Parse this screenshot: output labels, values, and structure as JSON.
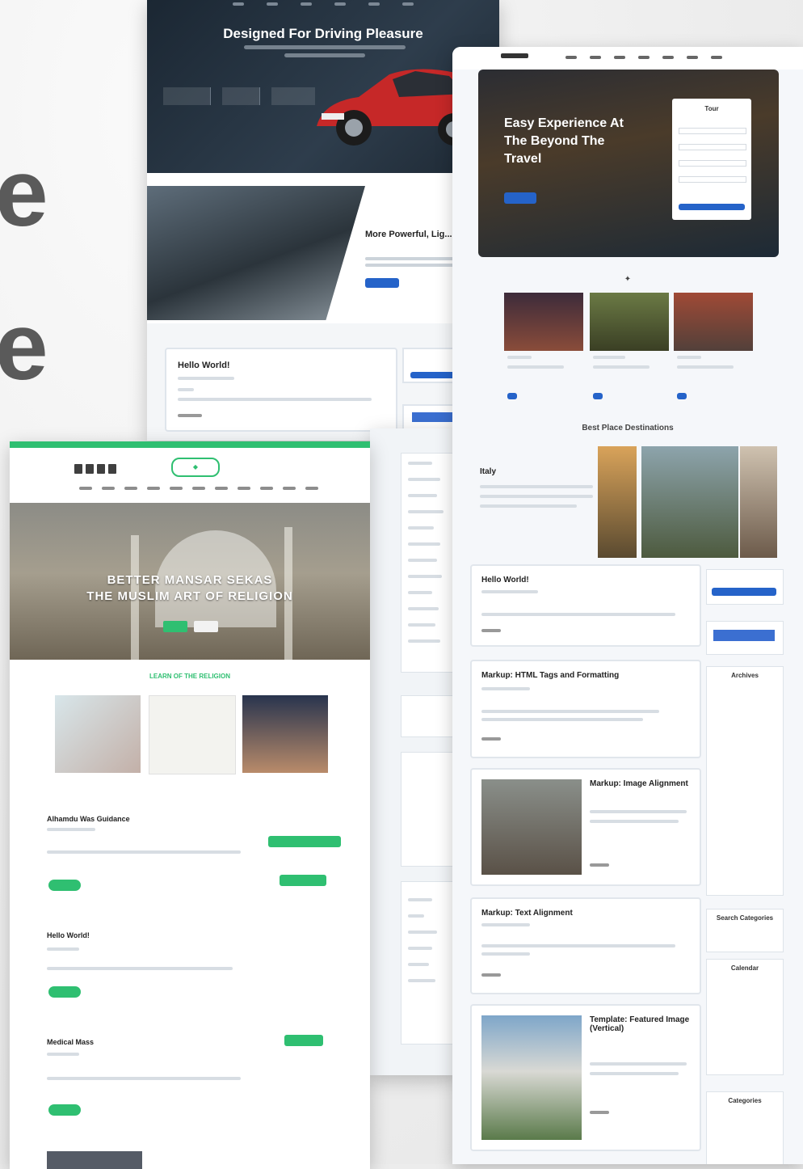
{
  "panel_car": {
    "hero_title": "Designed For Driving Pleasure",
    "feature_title": "More Powerful, Lig...",
    "post_title": "Hello World!"
  },
  "panel_islamic": {
    "hero_title_line1": "BETTER MANSAR SEKAS",
    "hero_title_line2": "THE MUSLIM ART OF RELIGION",
    "section_label": "LEARN OF THE RELIGION",
    "post1_title": "Alhamdu Was Guidance",
    "post2_title": "Hello World!",
    "post3_title": "Medical Mass"
  },
  "panel_travel": {
    "hero_title": "Easy Experience At The Beyond The Travel",
    "form_title": "Tour",
    "section1_title": "Best Place Destinations",
    "about_title": "Italy",
    "post1_title": "Hello World!",
    "post2_title": "Markup: HTML Tags and Formatting",
    "post3_title": "Markup: Image Alignment",
    "post4_title": "Markup: Text Alignment",
    "post5_title": "Template: Featured Image (Vertical)",
    "sidebar_archives": "Archives",
    "sidebar_search": "Search Categories",
    "sidebar_calendar": "Calendar",
    "sidebar_categories": "Categories"
  },
  "colors": {
    "green_accent": "#2fbf71",
    "blue_accent": "#2563c9",
    "car_red": "#c62828"
  }
}
